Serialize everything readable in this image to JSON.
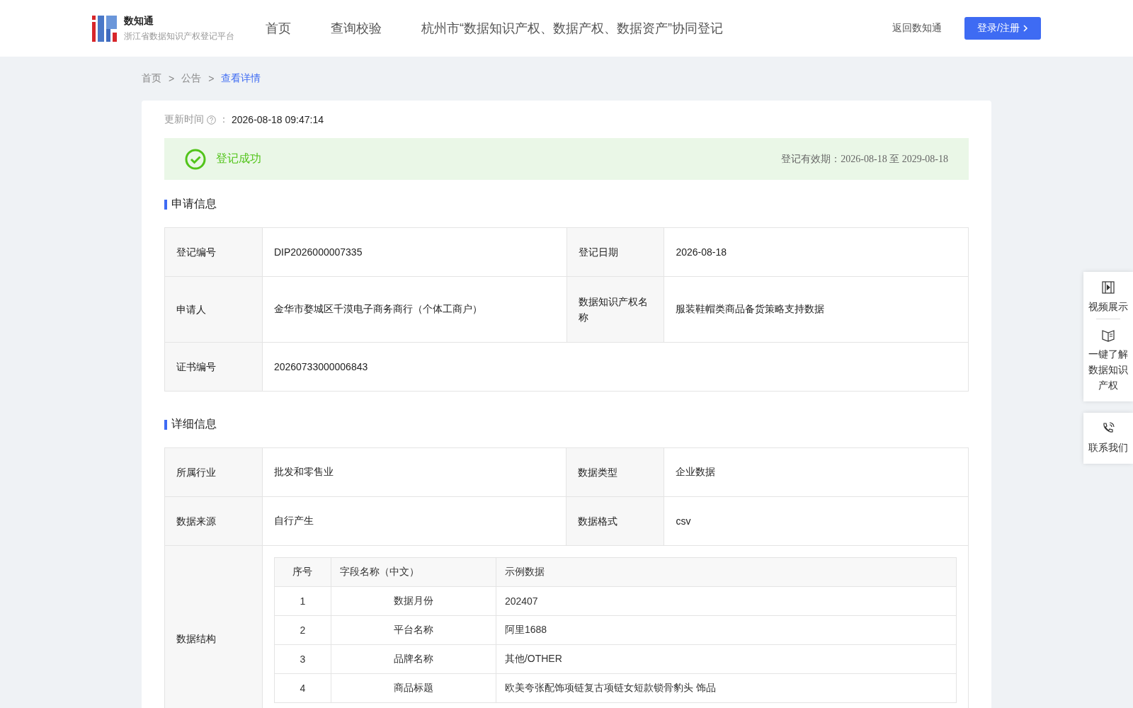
{
  "header": {
    "brand": "数知通",
    "subtitle": "浙江省数据知识产权登记平台",
    "nav": [
      {
        "label": "首页",
        "selected": false
      },
      {
        "label": "查询校验",
        "selected": false
      },
      {
        "label": "杭州市“数据知识产权、数据产权、数据资产”协同登记",
        "selected": false
      }
    ],
    "back_link": "返回数知通",
    "login_button": "登录/注册"
  },
  "breadcrumb": [
    {
      "label": "首页",
      "selected": false
    },
    {
      "label": "公告",
      "selected": false
    },
    {
      "label": "查看详情",
      "selected": true
    }
  ],
  "breadcrumb_separator": ">",
  "update": {
    "label": "更新时间",
    "colon": "：",
    "value": "2026-08-18 09:47:14"
  },
  "status": {
    "kind": "success",
    "label": "登记成功",
    "validity": "登记有效期：2026-08-18 至 2029-08-18"
  },
  "application": {
    "title": "申请信息",
    "rows": [
      {
        "cells": [
          {
            "label": "登记编号",
            "value": "DIP2026000007335"
          },
          {
            "label": "登记日期",
            "value": "2026-08-18"
          }
        ]
      },
      {
        "cells": [
          {
            "label": "申请人",
            "value": "金华市婺城区千漠电子商务商行（个体工商户）"
          },
          {
            "label": "数据知识产权名称",
            "value": "服装鞋帽类商品备货策略支持数据"
          }
        ]
      },
      {
        "cells": [
          {
            "label": "证书编号",
            "value": "20260733000006843"
          }
        ]
      }
    ]
  },
  "details": {
    "title": "详细信息",
    "rows": [
      {
        "cells": [
          {
            "label": "所属行业",
            "value": "批发和零售业"
          },
          {
            "label": "数据类型",
            "value": "企业数据"
          }
        ]
      },
      {
        "cells": [
          {
            "label": "数据来源",
            "value": "自行产生"
          },
          {
            "label": "数据格式",
            "value": "csv"
          }
        ]
      }
    ],
    "structure": {
      "label": "数据结构",
      "columns": [
        "序号",
        "字段名称（中文）",
        "示例数据"
      ],
      "rows": [
        [
          "1",
          "数据月份",
          "202407"
        ],
        [
          "2",
          "平台名称",
          "阿里1688"
        ],
        [
          "3",
          "品牌名称",
          "其他/OTHER"
        ],
        [
          "4",
          "商品标题",
          "欧美夸张配饰项链复古项链女短款锁骨豹头 饰品"
        ]
      ]
    }
  },
  "side_tools": [
    {
      "items": [
        {
          "kind": "video",
          "label": "视频展示"
        },
        {
          "kind": "book",
          "label": "一键了解数据知识产权"
        }
      ]
    },
    {
      "items": [
        {
          "kind": "phone",
          "label": "联系我们"
        }
      ]
    }
  ]
}
